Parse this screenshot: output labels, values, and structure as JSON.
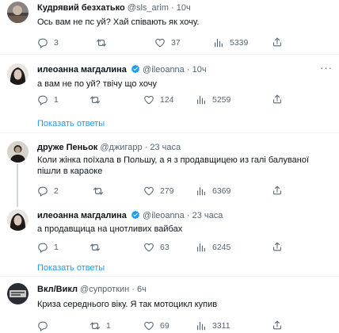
{
  "posts": [
    {
      "name": "Кудрявий безхатько",
      "handle": "@sls_arim",
      "dot": "·",
      "time": "10ч",
      "text": "Ось вам не пс  уй? Хай співають як хочу.",
      "replies": "3",
      "reposts": "",
      "likes": "37",
      "views": "5339",
      "verified": false
    },
    {
      "name": "илеоанна магдалина",
      "handle": "@ileoanna",
      "dot": "·",
      "time": "10ч",
      "text": "а вам не по  уй? твiчу що хочу",
      "replies": "1",
      "reposts": "",
      "likes": "124",
      "views": "5259",
      "verified": true,
      "show_replies": "Показать ответы"
    },
    {
      "name": "друже Пеньок",
      "handle": "@джигарр",
      "dot": "·",
      "time": "23 часа",
      "text": "Коли жінка поїхала в Польшу, а я з продавщицею из галі балуваної пішли в караоке",
      "replies": "2",
      "reposts": "",
      "likes": "279",
      "views": "6369",
      "verified": false
    },
    {
      "name": "илеоанна магдалина",
      "handle": "@ileoanna",
      "dot": "·",
      "time": "23 часа",
      "text": "а продавщица на цнотливих вайбах",
      "replies": "1",
      "reposts": "",
      "likes": "63",
      "views": "6245",
      "verified": true,
      "show_replies": "Показать ответы"
    },
    {
      "name": "Вкл/Викл",
      "handle": "@супроткин",
      "dot": "·",
      "time": "6ч",
      "text": "Криза середнього віку. Я так мотоцикл купив",
      "replies": "",
      "reposts": "1",
      "likes": "69",
      "views": "3311",
      "verified": false
    }
  ],
  "icons": {
    "reply": "reply-icon",
    "repost": "repost-icon",
    "like": "heart-icon",
    "views": "views-icon",
    "share": "share-icon",
    "more": "more-icon"
  },
  "colors": {
    "accent": "#1d9bf0",
    "secondary_text": "#536471",
    "verified": "#1d9bf0"
  }
}
